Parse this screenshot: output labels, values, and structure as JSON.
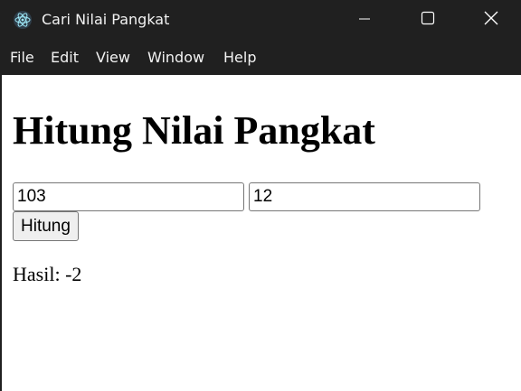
{
  "window": {
    "title": "Cari Nilai Pangkat",
    "app_icon": "electron-icon",
    "controls": [
      "minimize-icon",
      "maximize-icon",
      "close-icon"
    ]
  },
  "menu": {
    "items": [
      {
        "label": "File"
      },
      {
        "label": "Edit"
      },
      {
        "label": "View"
      },
      {
        "label": "Window"
      },
      {
        "label": "Help"
      }
    ]
  },
  "main": {
    "heading": "Hitung Nilai Pangkat",
    "base_input": {
      "value": "103"
    },
    "exponent_input": {
      "value": "12"
    },
    "calculate_label": "Hitung",
    "result_label": "Hasil: ",
    "result_value": "-2"
  },
  "colors": {
    "titlebar": "#202020",
    "content_bg": "#ffffff"
  }
}
